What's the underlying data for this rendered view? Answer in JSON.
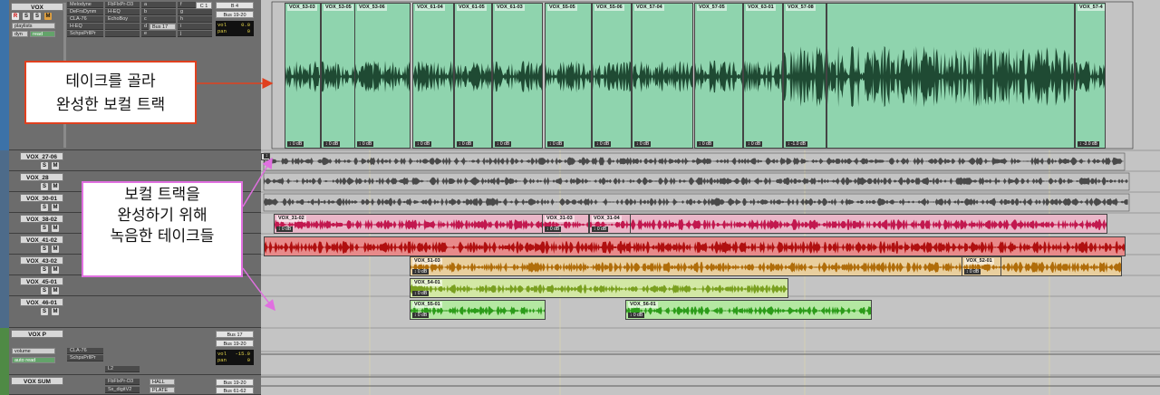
{
  "main_track": {
    "name": "VOX",
    "buttons": [
      "R",
      "S",
      "M"
    ],
    "playlist": "playlists",
    "automation_mode": "dyn",
    "automation_value": "read",
    "inserts": [
      "Melodyne",
      "DeFrsDynm",
      "CLA-76",
      "H-EQ",
      "SchpsPrllPr"
    ],
    "inserts_b": [
      "FbFlxPr-D3",
      "H-EQ",
      "EchoBoy",
      "",
      "",
      ""
    ],
    "sends_a": [
      "a",
      "b",
      "c",
      "d",
      "e"
    ],
    "send_bus": "Bus 17",
    "sends_b": [
      "f",
      "g",
      "h",
      "i",
      "j"
    ],
    "input": "C 1",
    "output_a": "B 4",
    "output_bus": "Bus 19-20",
    "vol_label": "vol",
    "vol": "0.0",
    "pan_label": "pan",
    "pan": "0"
  },
  "take_tracks": [
    {
      "name": "VOX_27-06",
      "s": "S",
      "m": "M"
    },
    {
      "name": "VOX_28",
      "s": "S",
      "m": "M"
    },
    {
      "name": "VOX_30-01",
      "s": "S",
      "m": "M"
    },
    {
      "name": "VOX_38-02",
      "s": "S",
      "m": "M"
    },
    {
      "name": "VOX_41-02",
      "s": "S",
      "m": "M"
    },
    {
      "name": "VOX_43-02",
      "s": "S",
      "m": "M"
    },
    {
      "name": "VOX_45-01",
      "s": "S",
      "m": "M"
    },
    {
      "name": "VOX_46-01",
      "s": "S",
      "m": "M"
    }
  ],
  "vox_p": {
    "name": "VOX P",
    "playlist": "volume",
    "automation": "auto read",
    "inserts": [
      "CLA-76",
      "SchpsPrllPr",
      "",
      "L2"
    ],
    "send_bus": "Bus 17",
    "output_bus": "Bus 19-20",
    "vol_label": "vol",
    "vol": "-15.0",
    "pan_label": "pan",
    "pan": "0"
  },
  "vox_sum": {
    "name": "VOX SUM",
    "inserts": [
      "FbFlxPr-D3",
      "Sx_digitV2"
    ],
    "send_hall": "HALL",
    "send_plate": "PLATE",
    "bus_a": "Bus 19-20",
    "bus_b": "Bus 61-62"
  },
  "comp_clips": [
    {
      "name": "VOX_53-03",
      "gain": "0 dB"
    },
    {
      "name": "VOX_53-05",
      "gain": "0 dB"
    },
    {
      "name": "VOX_53-06",
      "gain": "0 dB"
    },
    {
      "name": "VOX_61-04",
      "gain": "0 dB"
    },
    {
      "name": "VOX_61-05",
      "gain": "0 dB"
    },
    {
      "name": "VOX_61-03",
      "gain": "0 dB"
    },
    {
      "name": "VOX_55-05",
      "gain": "0 dB"
    },
    {
      "name": "VOX_55-06",
      "gain": "0 dB"
    },
    {
      "name": "VOX_57-04",
      "gain": "0 dB"
    },
    {
      "name": "VOX_57-05",
      "gain": "0 dB"
    },
    {
      "name": "VOX_63-01",
      "gain": "0 dB"
    },
    {
      "name": "VOX_57-08",
      "gain": "-1.0 dB"
    },
    {
      "name": "VOX_57-4",
      "gain": "-3.0 dB"
    }
  ],
  "take_clips": [
    {
      "name": "",
      "gain": "0 dB"
    },
    {
      "name": "VOX_31-02",
      "gain": "0 dB"
    },
    {
      "name": "VOX_31-03",
      "gain": "0 dB"
    },
    {
      "name": "VOX_31-04",
      "gain": "0 dB"
    },
    {
      "name": "VOX_51-03",
      "gain": "0 dB"
    },
    {
      "name": "VOX_52-01",
      "gain": "0 dB"
    },
    {
      "name": "VOX_54-01",
      "gain": "0 dB"
    },
    {
      "name": "VOX_55-01",
      "gain": "0 dB"
    },
    {
      "name": "VOX_56-01",
      "gain": "0 dB"
    }
  ],
  "callouts": {
    "top_line1": "테이크를 골라",
    "top_line2": "완성한 보컬 트랙",
    "bottom_line1": "보컬 트랙을",
    "bottom_line2": "완성하기 위해",
    "bottom_line3": "녹음한 테이크들"
  },
  "colors": {
    "comp_clip": "#8fd4ae",
    "comp_wave": "#1f4a33",
    "take_pink": "#eab6c8",
    "take_red": "#e88a8a",
    "take_orange": "#e9cf9e",
    "take_yellowgreen": "#d3e8a5",
    "take_green": "#b4e8a2",
    "callout_top_border": "#e0401f",
    "callout_bottom_border": "#e070e0"
  }
}
